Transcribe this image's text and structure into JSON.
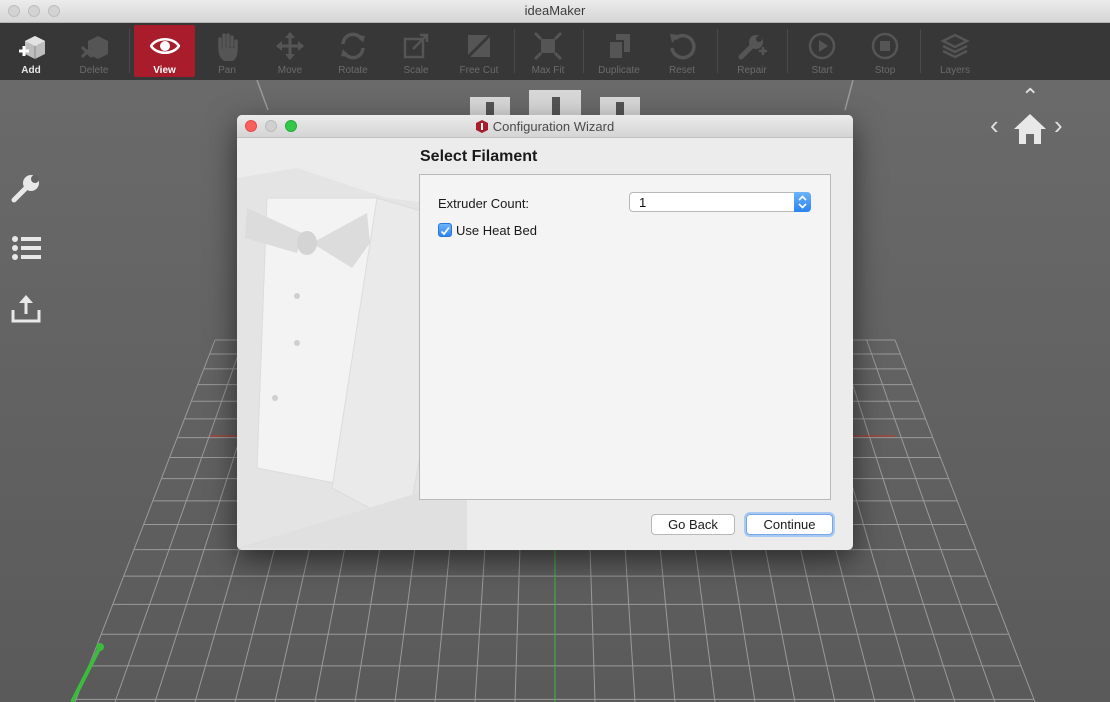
{
  "window": {
    "title": "ideaMaker"
  },
  "toolbar": {
    "items": [
      {
        "label": "Add",
        "icon": "add-icon"
      },
      {
        "label": "Delete",
        "icon": "delete-icon"
      },
      {
        "label": "View",
        "icon": "eye-icon"
      },
      {
        "label": "Pan",
        "icon": "hand-icon"
      },
      {
        "label": "Move",
        "icon": "move-icon"
      },
      {
        "label": "Rotate",
        "icon": "rotate-icon"
      },
      {
        "label": "Scale",
        "icon": "scale-icon"
      },
      {
        "label": "Free Cut",
        "icon": "free-cut-icon"
      },
      {
        "label": "Max Fit",
        "icon": "max-fit-icon"
      },
      {
        "label": "Duplicate",
        "icon": "duplicate-icon"
      },
      {
        "label": "Reset",
        "icon": "reset-icon"
      },
      {
        "label": "Repair",
        "icon": "repair-icon"
      },
      {
        "label": "Start",
        "icon": "play-icon"
      },
      {
        "label": "Stop",
        "icon": "stop-icon"
      },
      {
        "label": "Layers",
        "icon": "layers-icon"
      }
    ],
    "active": "View"
  },
  "sidebar": {
    "icons": [
      "wrench-icon",
      "list-icon",
      "upload-icon"
    ]
  },
  "dialog": {
    "title": "Configuration Wizard",
    "heading": "Select Filament",
    "extruder_label": "Extruder Count:",
    "extruder_value": "1",
    "heat_bed_label": "Use Heat Bed",
    "heat_bed_checked": true,
    "back_label": "Go Back",
    "continue_label": "Continue"
  },
  "colors": {
    "active_tool": "#a81c2b",
    "toolbar_bg": "#373737",
    "viewport_bg": "#636363",
    "axis_green": "#3dbb3d",
    "axis_red": "#c0392b"
  }
}
